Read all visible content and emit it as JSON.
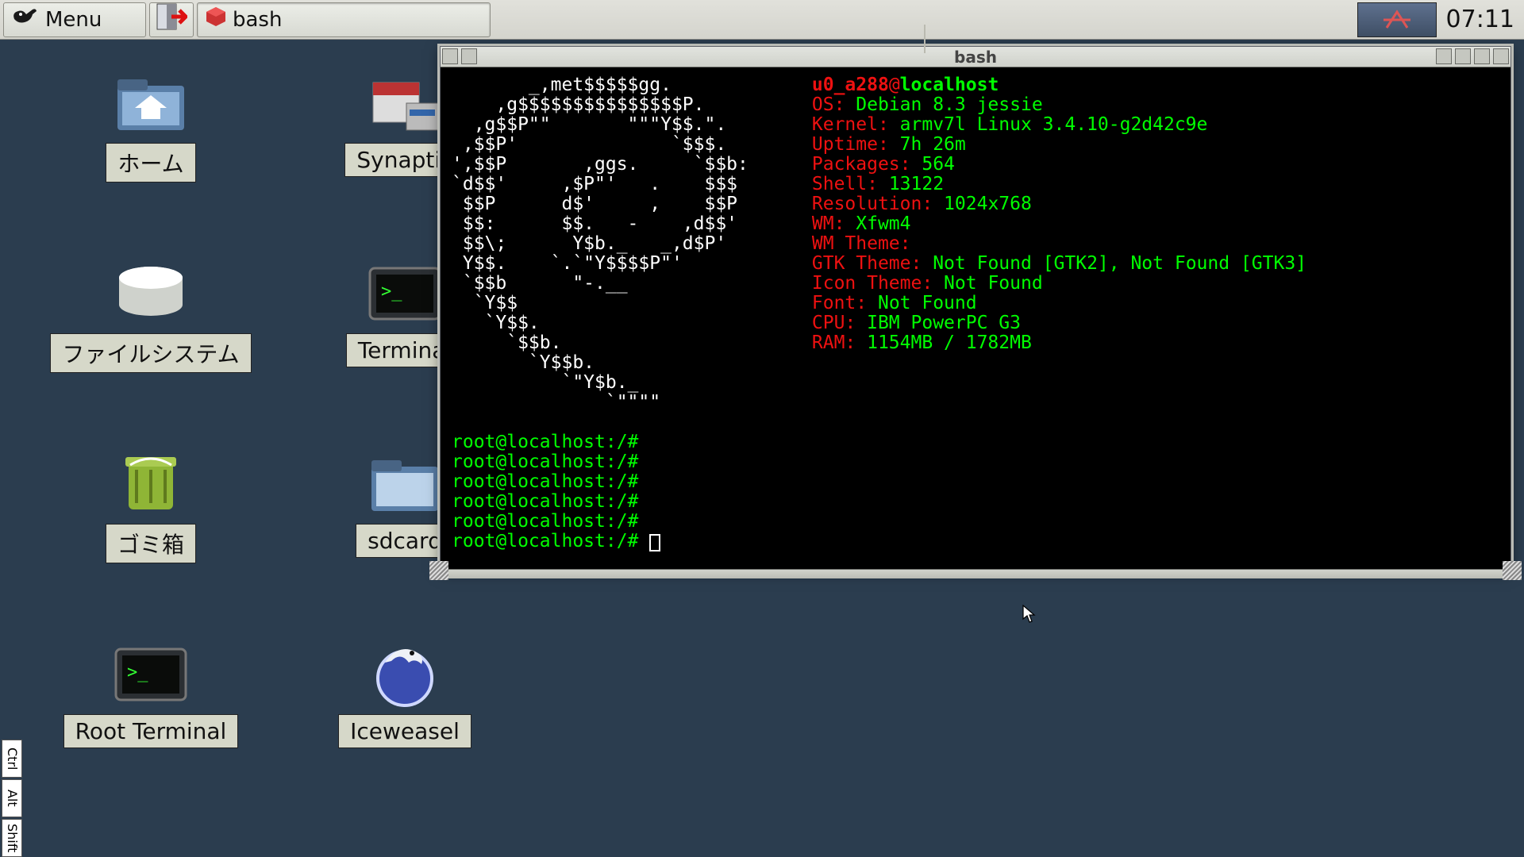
{
  "taskbar": {
    "menu_label": "Menu",
    "task_label": "bash",
    "clock": "07:11"
  },
  "desktop": {
    "home": "ホーム",
    "filesystem": "ファイルシステム",
    "trash": "ゴミ箱",
    "rootterm": "Root Terminal",
    "synaptic": "Synaptic",
    "terminal": "Terminal",
    "sdcard": "sdcard",
    "iceweasel": "Iceweasel"
  },
  "vkeys": {
    "ctrl": "Ctrl",
    "alt": "Alt",
    "shift": "Shift"
  },
  "terminal": {
    "title": "bash",
    "user": "u0_a288",
    "at": "@",
    "host": "localhost",
    "fields": {
      "os": {
        "k": "OS:",
        "v": " Debian 8.3 jessie"
      },
      "kernel": {
        "k": "Kernel:",
        "v": " armv7l Linux 3.4.10-g2d42c9e"
      },
      "uptime": {
        "k": "Uptime:",
        "v": " 7h 26m"
      },
      "packages": {
        "k": "Packages:",
        "v": " 564"
      },
      "shell": {
        "k": "Shell:",
        "v": " 13122"
      },
      "resolution": {
        "k": "Resolution:",
        "v": " 1024x768"
      },
      "wm": {
        "k": "WM:",
        "v": " Xfwm4"
      },
      "wmtheme": {
        "k": "WM Theme:",
        "v": ""
      },
      "gtktheme": {
        "k": "GTK Theme:",
        "v": " Not Found [GTK2], Not Found [GTK3]"
      },
      "icontheme": {
        "k": "Icon Theme:",
        "v": " Not Found"
      },
      "font": {
        "k": "Font:",
        "v": " Not Found"
      },
      "cpu": {
        "k": "CPU:",
        "v": " IBM PowerPC G3"
      },
      "ram": {
        "k": "RAM:",
        "v": " 1154MB / 1782MB"
      }
    },
    "ascii_art": "       _,met$$$$$gg.\n    ,g$$$$$$$$$$$$$$$P.\n  ,g$$P\"\"       \"\"\"Y$$.\".\n ,$$P'              `$$$.\n',$$P       ,ggs.     `$$b:\n`d$$'     ,$P\"'   .    $$$\n $$P      d$'     ,    $$P\n $$:      $$.   -    ,d$$'\n $$\\;      Y$b._   _,d$P'\n Y$$.    `.`\"Y$$$$P\"'\n `$$b      \"-.__\n  `Y$$\n   `Y$$.\n     `$$b.\n       `Y$$b.\n          `\"Y$b._\n              `\"\"\"\"",
    "prompt": "root@localhost:/#",
    "empty_prompts": 5
  }
}
